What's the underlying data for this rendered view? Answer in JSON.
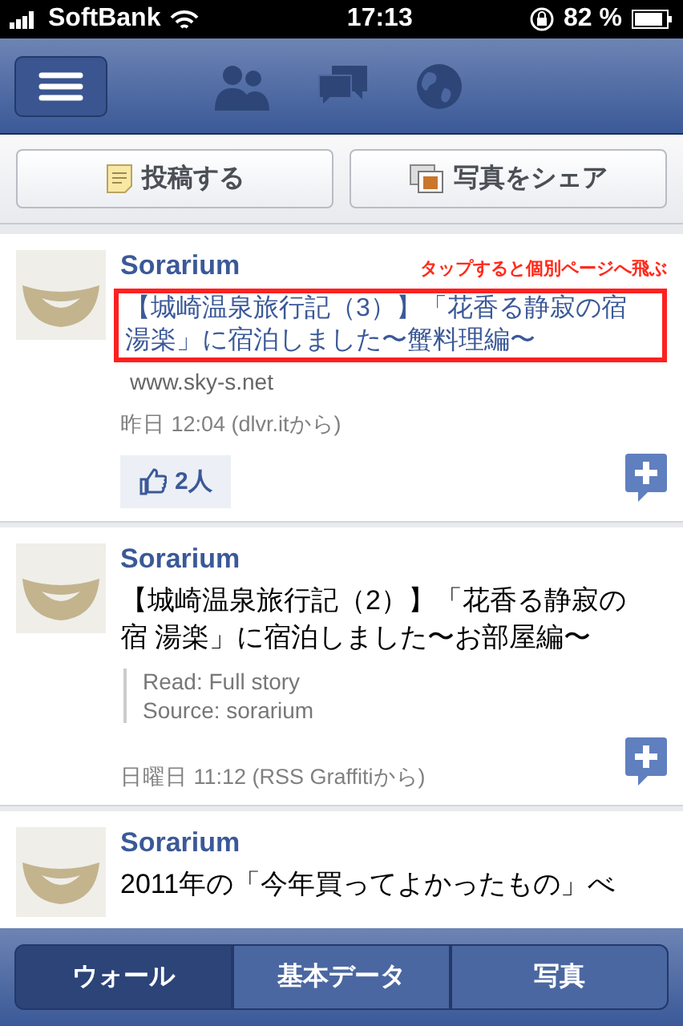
{
  "status_bar": {
    "carrier": "SoftBank",
    "time": "17:13",
    "battery": "82 %"
  },
  "actions": [
    {
      "kind": "post",
      "label": "投稿する"
    },
    {
      "kind": "photo",
      "label": "写真をシェア"
    }
  ],
  "posts": [
    {
      "kind": "link",
      "author": "Sorarium",
      "annotation": "タップすると個別ページへ飛ぶ",
      "title": "【城崎温泉旅行記（3）】「花香る静寂の宿湯楽」に宿泊しました〜蟹料理編〜",
      "domain": "www.sky-s.net",
      "time": "昨日 12:04 (dlvr.itから)",
      "likes": "2人"
    },
    {
      "kind": "story",
      "author": "Sorarium",
      "title": "【城崎温泉旅行記（2）】「花香る静寂の宿 湯楽」に宿泊しました〜お部屋編〜",
      "quote": [
        "Read: Full story",
        "Source: sorarium"
      ],
      "time": "日曜日 11:12 (RSS Graffitiから)"
    },
    {
      "kind": "story",
      "author": "Sorarium",
      "title": "2011年の「今年買ってよかったもの」べ"
    }
  ],
  "tabs": [
    {
      "label": "ウォール",
      "selected": true
    },
    {
      "label": "基本データ",
      "selected": false
    },
    {
      "label": "写真",
      "selected": false
    }
  ]
}
